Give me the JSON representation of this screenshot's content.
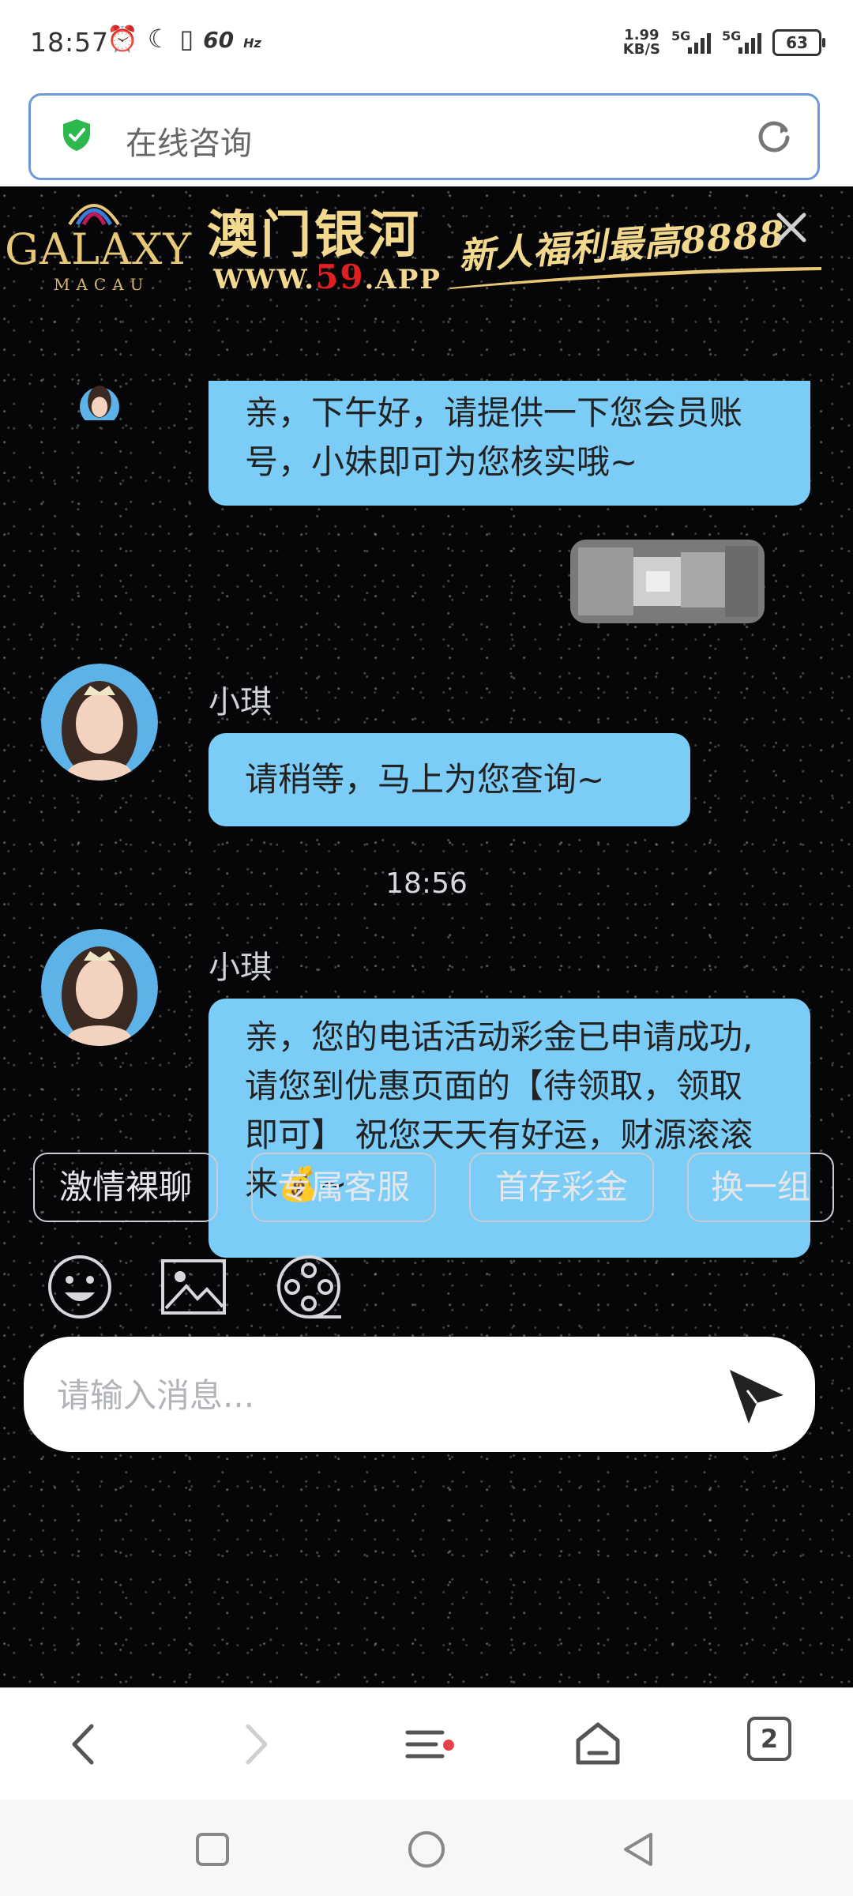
{
  "status_bar": {
    "time": "18:57",
    "refresh_rate": "60",
    "refresh_unit": "Hz",
    "net_speed_value": "1.99",
    "net_speed_unit": "KB/S",
    "signal1_label": "5G",
    "signal2_label": "5G",
    "battery": "63"
  },
  "address_bar": {
    "title": "在线咨询"
  },
  "banner": {
    "logo_word": "GALAXY",
    "logo_sub": "MACAU",
    "name_cn": "澳门银河",
    "url_prefix": "WWW.",
    "url_highlight": "59",
    "url_suffix": ".APP",
    "promo": "新人福利最高8888"
  },
  "messages": [
    {
      "sender": "",
      "text": "亲，下午好，请提供一下您会员账号，小妹即可为您核实哦~"
    },
    {
      "sender": "小琪",
      "text": "请稍等，马上为您查询~"
    },
    {
      "sender": "小琪",
      "text": "亲，您的电话活动彩金已申请成功,请您到优惠页面的【待领取，领取即可】 祝您天天有好运，财源滚滚来💰~"
    }
  ],
  "timestamp": "18:56",
  "quick_replies": [
    "激情裸聊",
    "专属客服",
    "首存彩金",
    "换一组"
  ],
  "input": {
    "placeholder": "请输入消息..."
  },
  "browser_toolbar": {
    "tabs_count": "2"
  },
  "colors": {
    "bubble": "#7bcdf7",
    "chat_background": "#060608",
    "address_border": "#6e98d8",
    "shield_green": "#2db84d",
    "gold": "#f3d98e",
    "menu_dot": "#e8424a"
  }
}
